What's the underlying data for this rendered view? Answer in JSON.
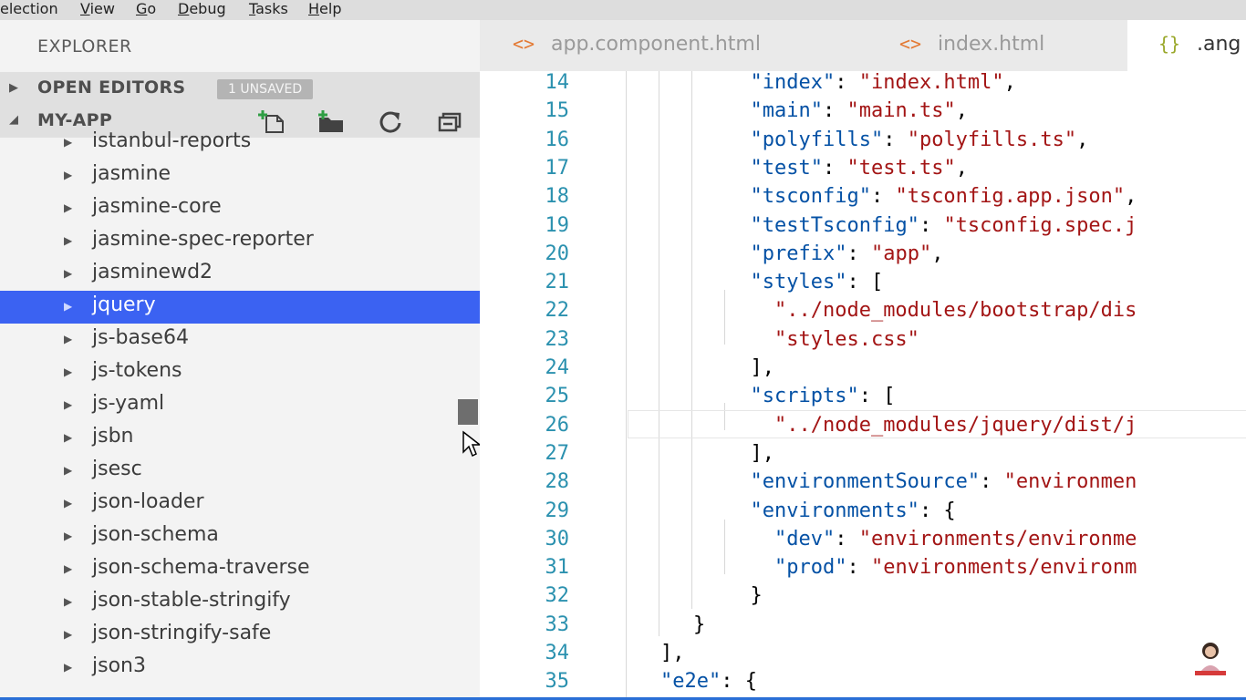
{
  "menu": [
    {
      "pre": "",
      "u": "",
      "post": "election"
    },
    {
      "pre": "",
      "u": "V",
      "post": "iew"
    },
    {
      "pre": "",
      "u": "G",
      "post": "o"
    },
    {
      "pre": "",
      "u": "D",
      "post": "ebug"
    },
    {
      "pre": "",
      "u": "T",
      "post": "asks"
    },
    {
      "pre": "",
      "u": "H",
      "post": "elp"
    }
  ],
  "sidebar": {
    "title": "EXPLORER",
    "open_editors": {
      "label": "OPEN EDITORS",
      "badge": "1 UNSAVED"
    },
    "project": {
      "label": "MY-APP"
    },
    "items": [
      {
        "label": "istanbul-reports"
      },
      {
        "label": "jasmine"
      },
      {
        "label": "jasmine-core"
      },
      {
        "label": "jasmine-spec-reporter"
      },
      {
        "label": "jasminewd2"
      },
      {
        "label": "jquery"
      },
      {
        "label": "js-base64"
      },
      {
        "label": "js-tokens"
      },
      {
        "label": "js-yaml"
      },
      {
        "label": "jsbn"
      },
      {
        "label": "jsesc"
      },
      {
        "label": "json-loader"
      },
      {
        "label": "json-schema"
      },
      {
        "label": "json-schema-traverse"
      },
      {
        "label": "json-stable-stringify"
      },
      {
        "label": "json-stringify-safe"
      },
      {
        "label": "json3"
      }
    ],
    "selected": "jquery"
  },
  "tabs": [
    {
      "icon": "<>",
      "label": "app.component.html"
    },
    {
      "icon": "<>",
      "label": "index.html"
    },
    {
      "icon": "{}",
      "label": ".ang"
    }
  ],
  "editor": {
    "lines": [
      {
        "n": "14",
        "text": "  \"index\": \"index.html\","
      },
      {
        "n": "15",
        "text": "  \"main\": \"main.ts\","
      },
      {
        "n": "16",
        "text": "  \"polyfills\": \"polyfills.ts\","
      },
      {
        "n": "17",
        "text": "  \"test\": \"test.ts\","
      },
      {
        "n": "18",
        "text": "  \"tsconfig\": \"tsconfig.app.json\","
      },
      {
        "n": "19",
        "text": "  \"testTsconfig\": \"tsconfig.spec.j"
      },
      {
        "n": "20",
        "text": "  \"prefix\": \"app\","
      },
      {
        "n": "21",
        "text": "  \"styles\": ["
      },
      {
        "n": "22",
        "text": "    \"../node_modules/bootstrap/dis"
      },
      {
        "n": "23",
        "text": "    \"styles.css\""
      },
      {
        "n": "24",
        "text": "  ],"
      },
      {
        "n": "25",
        "text": "  \"scripts\": ["
      },
      {
        "n": "26",
        "text": "    \"../node_modules/jquery/dist/j"
      },
      {
        "n": "27",
        "text": "  ],"
      },
      {
        "n": "28",
        "text": "  \"environmentSource\": \"environmen"
      },
      {
        "n": "29",
        "text": "  \"environments\": {"
      },
      {
        "n": "30",
        "text": "    \"dev\": \"environments/environme"
      },
      {
        "n": "31",
        "text": "    \"prod\": \"environments/environm"
      },
      {
        "n": "32",
        "text": "  }"
      },
      {
        "n": "33",
        "text": "}"
      },
      {
        "n": "34",
        "text": "],"
      },
      {
        "n": "35",
        "text": "\"e2e\": {"
      }
    ]
  },
  "colors": {
    "selection": "#3b62f2",
    "key": "#0451a5",
    "string": "#a31515",
    "line_number": "#2b91af",
    "icon_orange": "#e37933"
  }
}
